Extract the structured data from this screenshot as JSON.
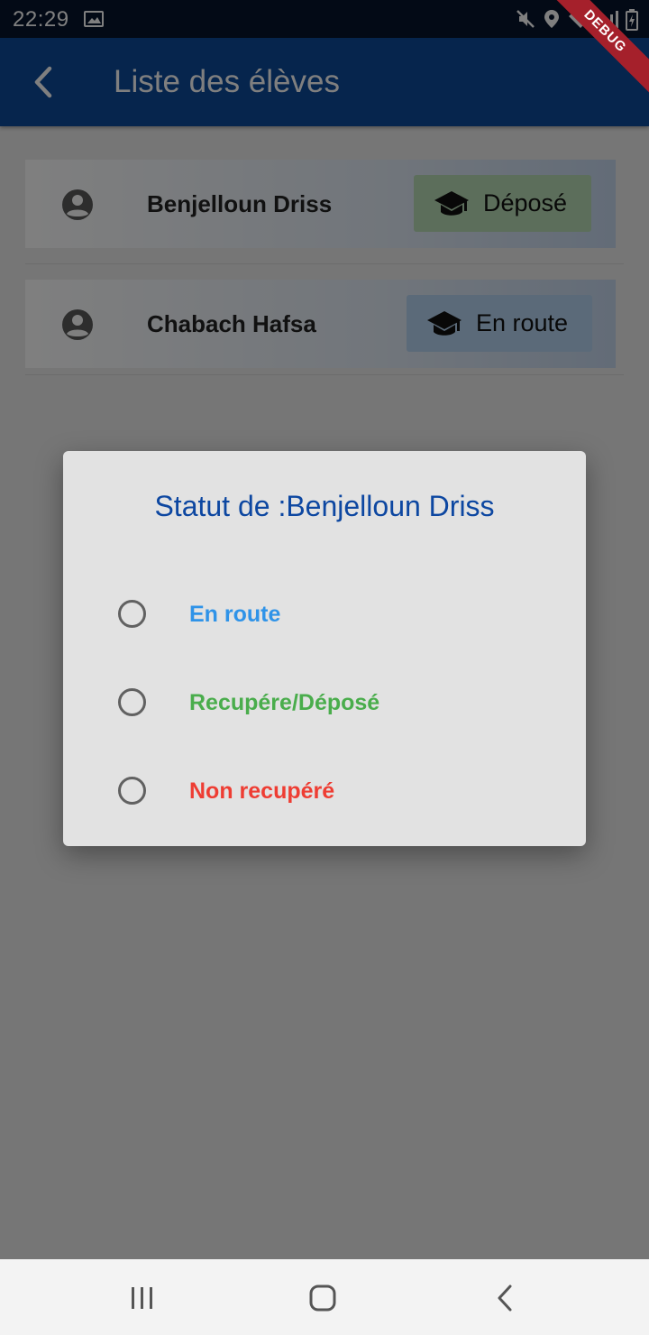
{
  "status_bar": {
    "time": "22:29",
    "icons": [
      "image-icon",
      "mute-icon",
      "location-icon",
      "wifi-icon",
      "signal-icon",
      "battery-icon"
    ]
  },
  "debug_banner": "DEBUG",
  "app_bar": {
    "title": "Liste des élèves",
    "back_icon": "chevron-left-icon"
  },
  "students": [
    {
      "name": "Benjelloun Driss",
      "status_label": "Déposé",
      "status_color": "#b9dcb6",
      "icon": "graduation-cap-icon"
    },
    {
      "name": "Chabach Hafsa",
      "status_label": "En route",
      "status_color": "#b7d5f3",
      "icon": "graduation-cap-icon"
    }
  ],
  "dialog": {
    "title": "Statut de :Benjelloun Driss",
    "options": [
      {
        "label": "En route",
        "color": "#2f93e8",
        "selected": false
      },
      {
        "label": "Recupére/Déposé",
        "color": "#4aad4c",
        "selected": false
      },
      {
        "label": "Non recupéré",
        "color": "#ee3d33",
        "selected": false
      }
    ]
  },
  "nav_bar": {
    "buttons": [
      "recent-apps-icon",
      "home-icon",
      "back-icon"
    ]
  },
  "colors": {
    "app_bar": "#0d4a9b",
    "status_bar": "#07152d",
    "dialog_title": "#0d47a1"
  }
}
